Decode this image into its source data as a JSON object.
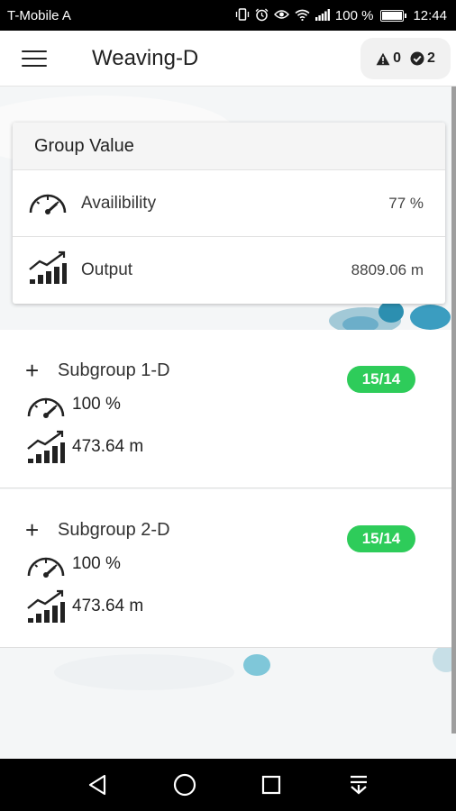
{
  "status_bar": {
    "carrier": "T-Mobile A",
    "battery_percent": "100 %",
    "time": "12:44",
    "icons": [
      "vibrate-icon",
      "alarm-icon",
      "eye-icon",
      "wifi-icon",
      "signal-icon",
      "battery-charging-icon"
    ]
  },
  "app_bar": {
    "title": "Weaving-D",
    "warnings_count": "0",
    "ok_count": "2"
  },
  "group_card": {
    "header": "Group Value",
    "availability": {
      "label": "Availibility",
      "value": "77 %",
      "icon": "gauge-icon"
    },
    "output": {
      "label": "Output",
      "value": "8809.06 m",
      "icon": "output-chart-icon"
    }
  },
  "subgroups": [
    {
      "title": "Subgroup 1-D",
      "badge": "15/14",
      "availability": "100 %",
      "output": "473.64 m"
    },
    {
      "title": "Subgroup 2-D",
      "badge": "15/14",
      "availability": "100 %",
      "output": "473.64 m"
    }
  ],
  "colors": {
    "badge": "#2ecc5a",
    "status_bar": "#000000",
    "accent_blob": "#2c8fb0"
  }
}
